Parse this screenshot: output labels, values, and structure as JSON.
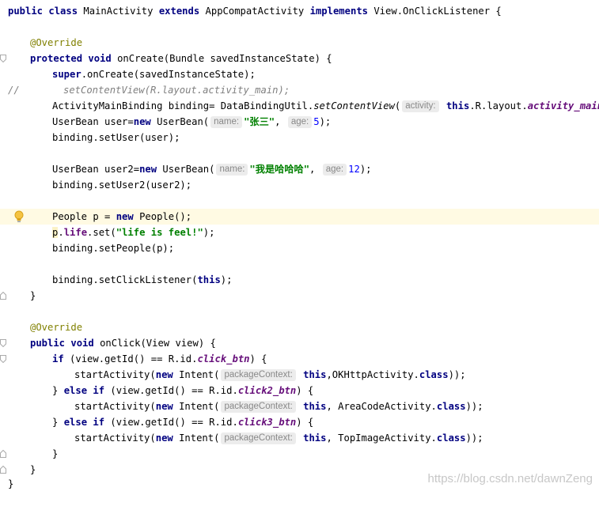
{
  "code": {
    "class_decl": {
      "kw1": "public",
      "kw2": "class",
      "name": "MainActivity",
      "kw3": "extends",
      "parent": "AppCompatActivity",
      "kw4": "implements",
      "iface": "View.OnClickListener {"
    },
    "override1": "@Override",
    "oncreate_sig": {
      "kw1": "protected",
      "kw2": "void",
      "rest": "onCreate(Bundle savedInstanceState) {"
    },
    "super_call": {
      "kw": "super",
      "rest": ".onCreate(savedInstanceState);"
    },
    "comment_slashes": "//",
    "comment_text": "setContentView(R.layout.activity_main);",
    "binding_line": {
      "a": "ActivityMainBinding binding= DataBindingUtil.",
      "method": "setContentView",
      "open": "(",
      "hint": "activity:",
      "kw": "this",
      "mid": ".R.layout.",
      "field": "activity_main",
      "close": ");"
    },
    "user_line": {
      "a": "UserBean user=",
      "kw": "new",
      "b": " UserBean(",
      "hint1": "name:",
      "str": "\"张三\"",
      "comma": ",",
      "hint2": "age:",
      "num": "5",
      "close": ");"
    },
    "setuser_line": "binding.setUser(user);",
    "user2_line": {
      "a": "UserBean user2=",
      "kw": "new",
      "b": " UserBean(",
      "hint1": "name:",
      "str": "\"我是哈哈哈\"",
      "comma": ",",
      "hint2": "age:",
      "num": "12",
      "close": ");"
    },
    "setuser2_line": "binding.setUser2(user2);",
    "people_line": {
      "a": "People p = ",
      "kw": "new",
      "b": " People();"
    },
    "life_line": {
      "p": "p",
      "dot": ".",
      "field": "life",
      "set": ".set(",
      "str": "\"life is feel!\"",
      "close": ");"
    },
    "setpeople_line": "binding.setPeople(p);",
    "setclick_line": {
      "a": "binding.setClickListener(",
      "kw": "this",
      "close": ");"
    },
    "close_brace": "}",
    "override2": "@Override",
    "onclick_sig": {
      "kw1": "public",
      "kw2": "void",
      "rest": "onClick(View view) {"
    },
    "if1": {
      "kw": "if",
      "a": " (view.getId() == R.id.",
      "field": "click_btn",
      "close": ") {"
    },
    "start1": {
      "a": "startActivity(",
      "kw": "new",
      "b": " Intent(",
      "hint": "packageContext:",
      "kw2": "this",
      "c": ",OKHttpActivity.",
      "kw3": "class",
      "close": "));"
    },
    "elseif2": {
      "brace": "} ",
      "kw": "else if",
      "a": " (view.getId() == R.id.",
      "field": "click2_btn",
      "close": ") {"
    },
    "start2": {
      "a": "startActivity(",
      "kw": "new",
      "b": " Intent(",
      "hint": "packageContext:",
      "kw2": "this",
      "c": ", AreaCodeActivity.",
      "kw3": "class",
      "close": "));"
    },
    "elseif3": {
      "brace": "} ",
      "kw": "else if",
      "a": " (view.getId() == R.id.",
      "field": "click3_btn",
      "close": ") {"
    },
    "start3": {
      "a": "startActivity(",
      "kw": "new",
      "b": " Intent(",
      "hint": "packageContext:",
      "kw2": "this",
      "c": ", TopImageActivity.",
      "kw3": "class",
      "close": "));"
    }
  },
  "watermark": "https://blog.csdn.net/dawnZeng"
}
